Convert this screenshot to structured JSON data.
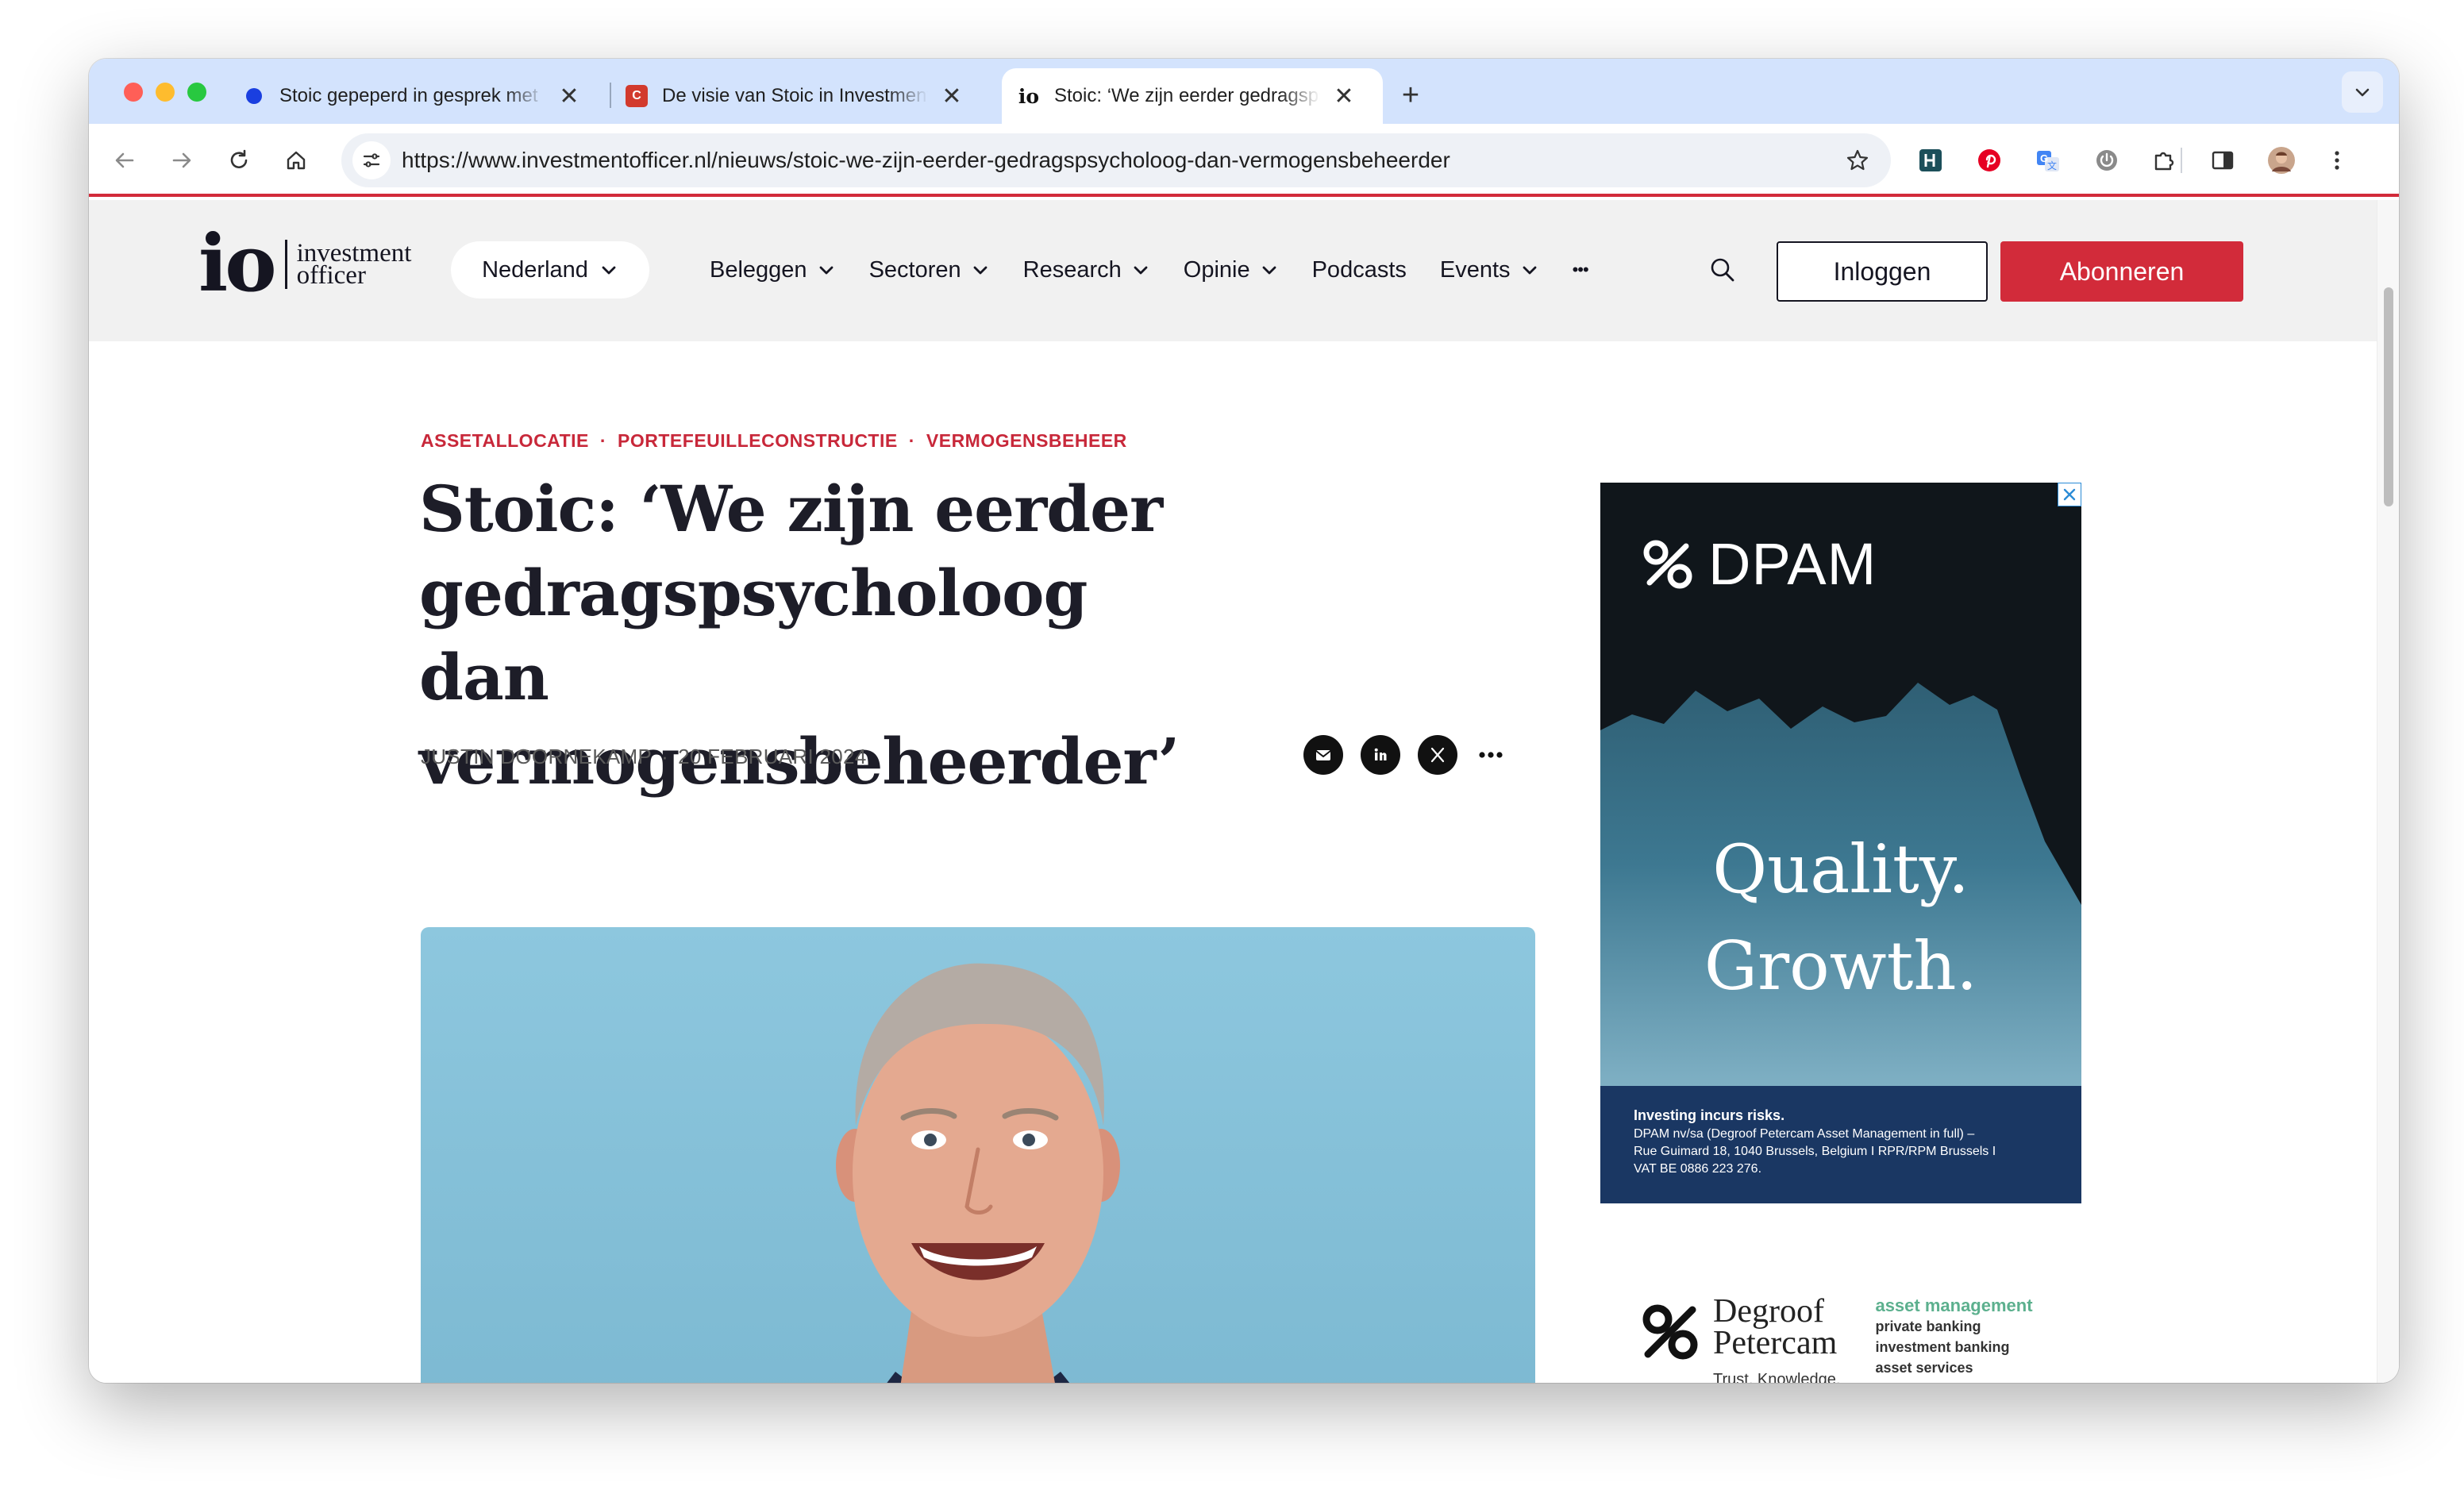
{
  "browser": {
    "tabs": [
      {
        "title": "Stoic gepeperd in gesprek met",
        "close": "✕"
      },
      {
        "title": "De visie van Stoic in Investment",
        "favicon": "C",
        "close": "✕"
      },
      {
        "title": "Stoic: ‘We zijn eerder gedragsps",
        "favicon": "io",
        "close": "✕",
        "active": true
      }
    ],
    "new_tab": "+",
    "url": "https://www.investmentofficer.nl/nieuws/stoic-we-zijn-eerder-gedragspsycholoog-dan-vermogensbeheerder"
  },
  "site": {
    "logo": {
      "mark": "io",
      "line1": "investment",
      "line2": "officer"
    },
    "country": "Nederland",
    "menu": [
      "Beleggen",
      "Sectoren",
      "Research",
      "Opinie",
      "Podcasts",
      "Events"
    ],
    "more": "•••",
    "login": "Inloggen",
    "subscribe": "Abonneren"
  },
  "article": {
    "categories": [
      "ASSETALLOCATIE",
      "PORTEFEUILLECONSTRUCTIE",
      "VERMOGENSBEHEER"
    ],
    "separator": "·",
    "headline": "Stoic: ‘We zijn eerder gedragspsycholoog dan vermogensbeheerder’",
    "author": "JUSTIN DOORNEKAMP",
    "date": "20 FEBRUARI 2024",
    "share_more": "•••"
  },
  "ad": {
    "brand": "DPAM",
    "slogan_1": "Quality.",
    "slogan_2": "Growth.",
    "disclaimer_title": "Investing incurs risks.",
    "disclaimer_1": "DPAM nv/sa (Degroof Petercam Asset Management in full) –",
    "disclaimer_2": "Rue Guimard 18, 1040 Brussels, Belgium I RPR/RPM Brussels I",
    "disclaimer_3": "VAT BE 0886 223 276."
  },
  "sponsor": {
    "name_1": "Degroof",
    "name_2": "Petercam",
    "tagline": "Trust. Knowledge.",
    "services": [
      "asset management",
      "private banking",
      "investment banking",
      "asset services"
    ]
  },
  "colors": {
    "accent": "#d22b3a",
    "category": "#c8283a",
    "tabstrip": "#d3e3fd",
    "ad_footer": "#1a3763"
  }
}
